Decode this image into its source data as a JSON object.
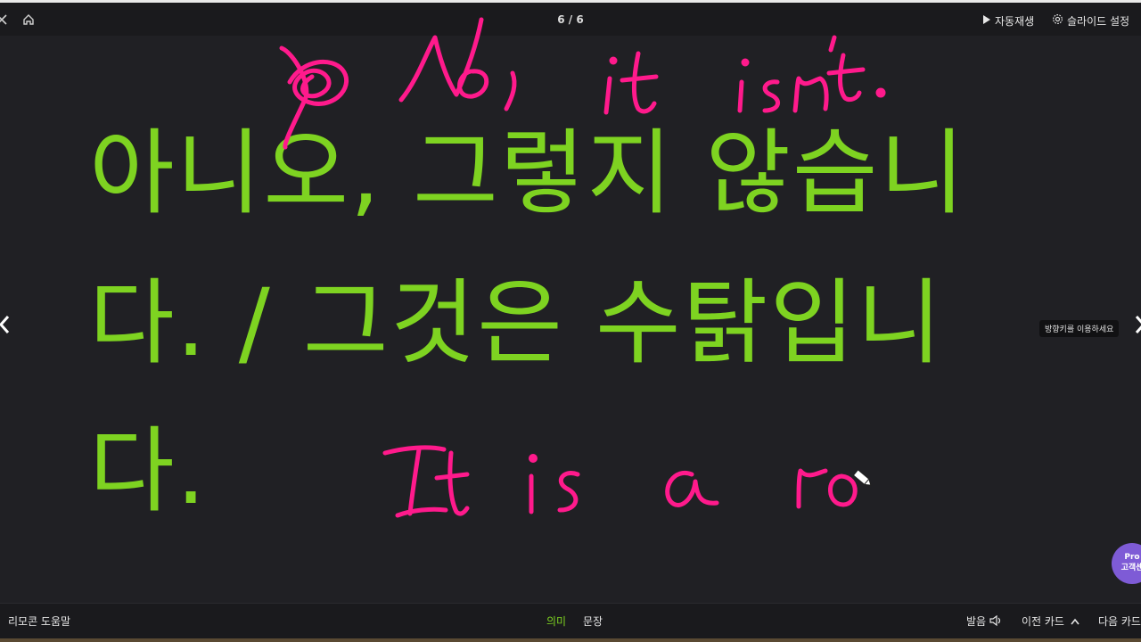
{
  "topbar": {
    "counter": "6 / 6",
    "autoplay_label": "자동재생",
    "settings_label": "슬라이드 설정"
  },
  "slide": {
    "text_lines": [
      "아니오, 그렇지 않습니",
      "다. / 그것은 수탉입니",
      "다."
    ],
    "text_color": "#7ed321",
    "annotation_color": "#ff1a8c",
    "handwriting_top": "No, it isn't.",
    "handwriting_bottom": "It is a ro"
  },
  "tooltip": "방향키를 이용하세요",
  "pro_bubble": {
    "line1": "Pro",
    "line2": "고객센"
  },
  "bottombar": {
    "help_label": "리모콘 도움말",
    "tab_meaning": "의미",
    "tab_sentence": "문장",
    "pronounce_label": "발음",
    "prev_card_label": "이전 카드",
    "next_card_label": "다음 카드"
  },
  "icons": [
    "close-icon",
    "home-icon",
    "play-icon",
    "gear-icon",
    "chevron-left-icon",
    "chevron-right-icon",
    "speaker-icon",
    "chevron-up-icon",
    "pencil-cursor-icon"
  ]
}
